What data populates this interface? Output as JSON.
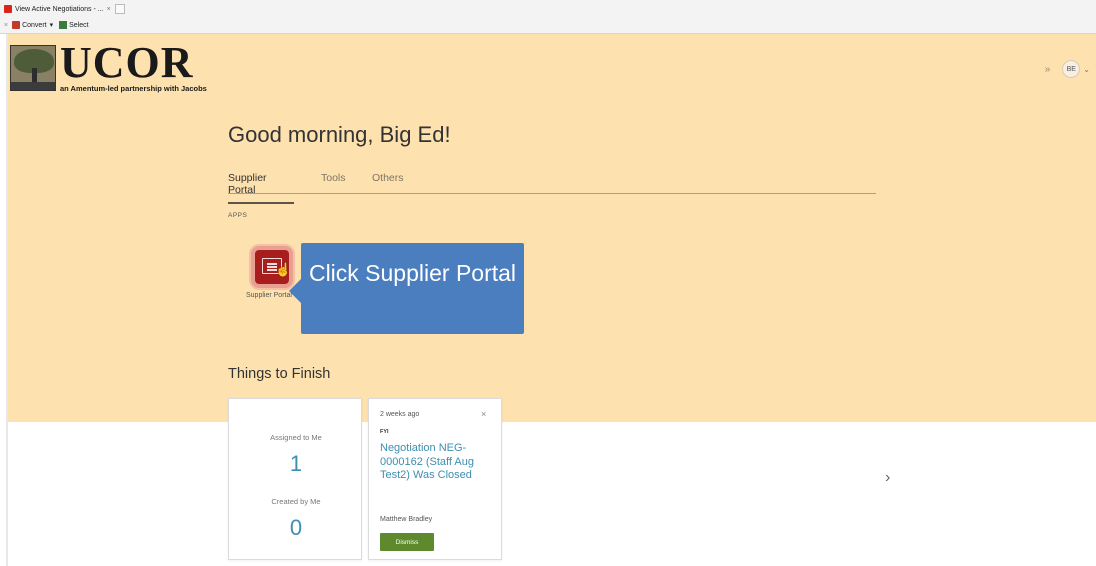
{
  "browser": {
    "tab_title": "View Active Negotiations - ...",
    "tab_close": "×",
    "toolbar_close": "×",
    "convert_label": "Convert",
    "convert_caret": "▾",
    "select_label": "Select"
  },
  "header": {
    "logo_word": "UCOR",
    "logo_tagline": "an Amentum-led partnership with Jacobs",
    "expand_icon": "»",
    "avatar_initials": "BE",
    "avatar_caret": "⌄"
  },
  "main": {
    "greeting": "Good morning, Big Ed!",
    "tabs": [
      {
        "label": "Supplier Portal",
        "selected": true
      },
      {
        "label": "Tools",
        "selected": false
      },
      {
        "label": "Others",
        "selected": false
      }
    ],
    "apps_label": "APPS",
    "apps": [
      {
        "label": "Supplier Portal",
        "icon": "supplier-portal-icon",
        "color": "#a81e1e"
      }
    ],
    "things_to_finish_label": "Things to Finish",
    "counts_card": {
      "assigned_label": "Assigned to Me",
      "assigned_count": "1",
      "created_label": "Created by Me",
      "created_count": "0"
    },
    "notification_card": {
      "time": "2 weeks ago",
      "close": "×",
      "type": "FYI",
      "title": "Negotiation NEG-0000162 (Staff Aug Test2) Was Closed",
      "person": "Matthew Bradley",
      "dismiss_label": "Dismiss"
    },
    "next_arrow": "›"
  },
  "callout": {
    "text": "Click Supplier Portal",
    "color": "#4a7ebf"
  },
  "colors": {
    "page_background": "#fde1ae",
    "accent": "#3d8fb0",
    "dismiss_button": "#5e8a2d"
  }
}
